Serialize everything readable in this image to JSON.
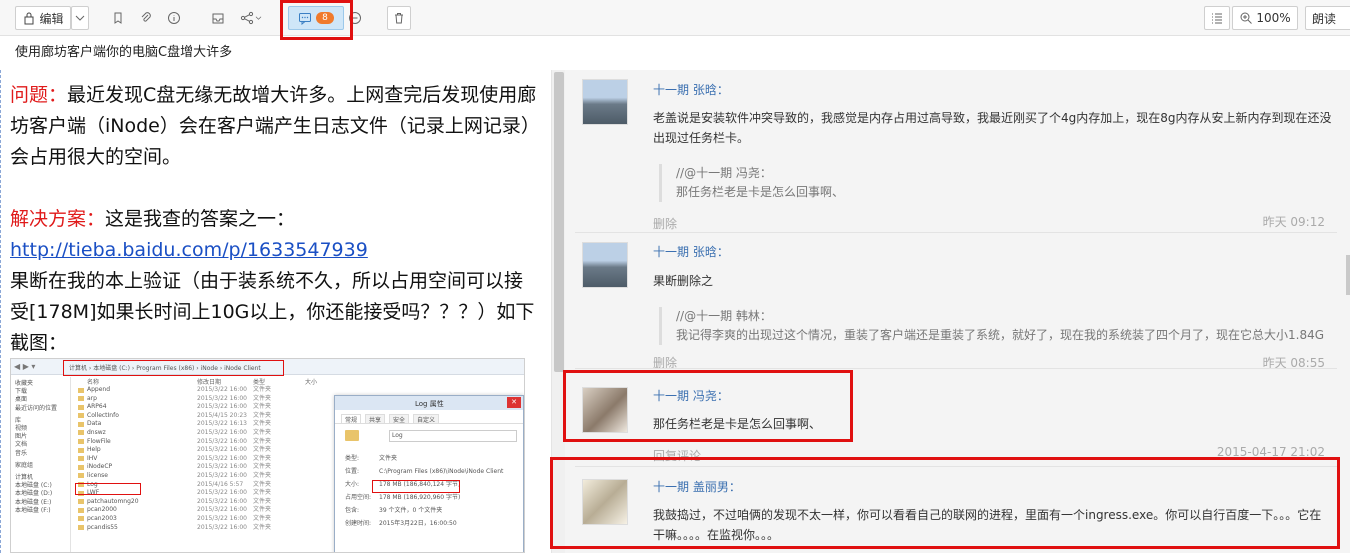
{
  "toolbar": {
    "edit_label": "编辑",
    "comment_count": "8",
    "zoom": "100%",
    "read_label": "朗读"
  },
  "doc": {
    "title": "使用廊坊客户端你的电脑C盘增大许多"
  },
  "article": {
    "q_label": "问题：",
    "q_text": "最近发现C盘无缘无故增大许多。上网查完后发现使用廊坊客户端（iNode）会在客户端产生日志文件（记录上网记录）会占用很大的空间。",
    "s_label": "解决方案：",
    "s_text": "这是我查的答案之一：",
    "link": "http://tieba.baidu.com/p/1633547939",
    "s_text2": "果断在我的本上验证（由于装系统不久，所以占用空间可以接受[178M]如果长时间上10G以上，你还能接受吗？？？）如下截图："
  },
  "screenshot": {
    "path": "计算机 › 本地磁盘 (C:) › Program Files (x86) › iNode › iNode Client",
    "col_name": "名称",
    "col_date": "修改日期",
    "col_type": "类型",
    "col_size": "大小",
    "nav": [
      "收藏夹",
      "下载",
      "桌面",
      "最近访问的位置",
      "库",
      "视频",
      "图片",
      "文档",
      "音乐",
      "家庭组",
      "计算机",
      "本地磁盘 (C:)",
      "本地磁盘 (D:)",
      "本地磁盘 (E:)",
      "本地磁盘 (F:)"
    ],
    "files": [
      "Append",
      "arp",
      "ARP64",
      "CollectInfo",
      "Data",
      "dnswz",
      "FlowFile",
      "Help",
      "IHV",
      "iNodeCP",
      "license",
      "Log",
      "LWF",
      "patchautomng20",
      "pcan2000",
      "pcan2003",
      "pcandis55"
    ],
    "dates": [
      "2015/3/22 16:00",
      "2015/3/22 16:00",
      "2015/3/22 16:00",
      "2015/4/15 20:23",
      "2015/3/22 16:13",
      "2015/3/22 16:00",
      "2015/3/22 16:00",
      "2015/3/22 16:00",
      "2015/3/22 16:00",
      "2015/3/22 16:00",
      "2015/3/22 16:00",
      "2015/4/16 5:57",
      "2015/3/22 16:00",
      "2015/3/22 16:00",
      "2015/3/22 16:00",
      "2015/3/22 16:00",
      "2015/3/22 16:00"
    ],
    "ftype": "文件夹",
    "dlg_title": "Log 属性",
    "dlg_tabs": [
      "常规",
      "共享",
      "安全",
      "自定义"
    ],
    "dlg_name": "Log",
    "dlg_rows": [
      [
        "类型:",
        "文件夹"
      ],
      [
        "位置:",
        "C:\\Program Files (x86)\\iNode\\iNode Client"
      ],
      [
        "大小:",
        "178 MB (186,840,124 字节)"
      ],
      [
        "占用空间:",
        "178 MB (186,920,960 字节)"
      ],
      [
        "包含:",
        "39 个文件，0 个文件夹"
      ],
      [
        "创建时间:",
        "2015年3月22日，16:00:50"
      ]
    ]
  },
  "comments": [
    {
      "author": "十一期 张晗：",
      "text": "老盖说是安装软件冲突导致的，我感觉是内存占用过高导致，我最近刚买了个4g内存加上，现在8g内存从安上新内存到现在还没出现过任务栏卡。",
      "quote_author": "//@十一期 冯尧：",
      "quote_text": "那任务栏老是卡是怎么回事啊、",
      "del": "删除",
      "time": "昨天 09:12"
    },
    {
      "author": "十一期 张晗：",
      "text": "果断删除之",
      "quote_author": "//@十一期 韩林：",
      "quote_text": "我记得李爽的出现过这个情况，重装了客户端还是重装了系统，就好了，现在我的系统装了四个月了，现在它总大小1.84G",
      "del": "删除",
      "time": "昨天 08:55"
    },
    {
      "author": "十一期 冯尧：",
      "text": "那任务栏老是卡是怎么回事啊、",
      "del": "回复评论",
      "time": "2015-04-17 21:02"
    },
    {
      "author": "十一期 盖丽男：",
      "text": "我鼓捣过，不过咱俩的发现不太一样，你可以看看自己的联网的进程，里面有一个ingress.exe。你可以自行百度一下。。。它在干嘛。。。。在监视你。。。"
    }
  ]
}
